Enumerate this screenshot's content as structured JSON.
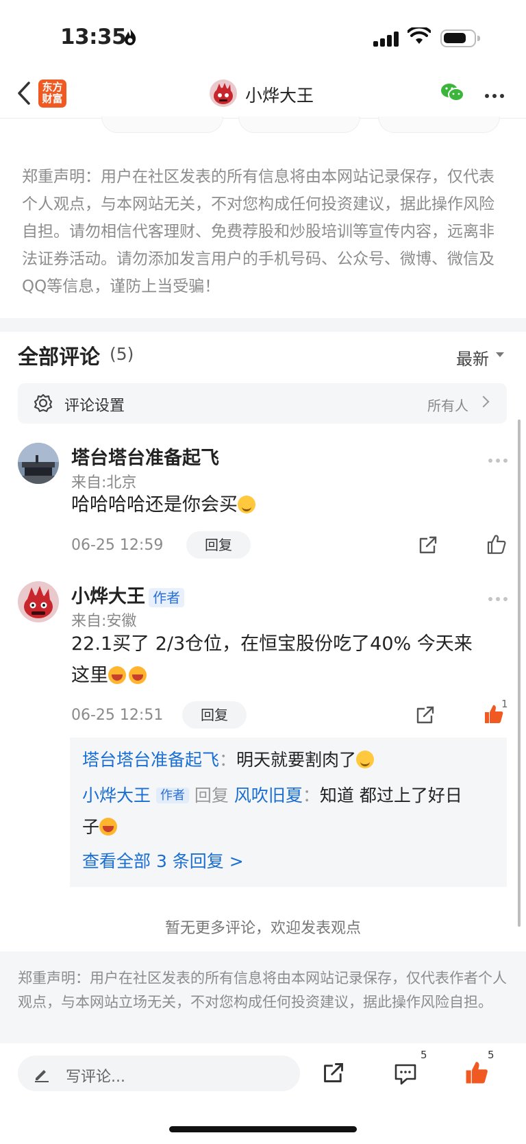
{
  "status_bar": {
    "time": "13:35"
  },
  "nav": {
    "logo_line1": "东方",
    "logo_line2": "财富",
    "title": "小烨大王"
  },
  "disclaimer_top": "郑重声明：用户在社区发表的所有信息将由本网站记录保存，仅代表个人观点，与本网站无关，不对您构成任何投资建议，据此操作风险自担。请勿相信代客理财、免费荐股和炒股培训等宣传内容，远离非法证券活动。请勿添加发言用户的手机号码、公众号、微博、微信及QQ等信息，谨防上当受骗！",
  "comments_header": {
    "title": "全部评论",
    "count": "(5)",
    "sort": "最新"
  },
  "comment_settings": {
    "label": "评论设置",
    "value": "所有人"
  },
  "comments": [
    {
      "user": "塔台塔台准备起飞",
      "from": "来自:北京",
      "text": "哈哈哈哈还是你会买",
      "emoji": "thinking-emoji",
      "date": "06-25 12:59",
      "reply_label": "回复"
    },
    {
      "user": "小烨大王",
      "author_badge": "作者",
      "from": "来自:安徽",
      "text_line1": "22.1买了 2/3仓位，在恒宝股份吃了40%  今天来",
      "text_line2": "这里",
      "date": "06-25 12:51",
      "reply_label": "回复",
      "like_count": "1",
      "replies": [
        {
          "user": "塔台塔台准备起飞",
          "sep": "：",
          "text": "明天就要割肉了"
        },
        {
          "user": "小烨大王",
          "author_badge": "作者",
          "reply_word": "回复",
          "target": "风吹旧夏",
          "sep": "：",
          "text1": "知道 都过上了好日",
          "text2": "子"
        }
      ],
      "view_all": "查看全部 3 条回复 >"
    }
  ],
  "no_more": "暂无更多评论，欢迎发表观点",
  "disclaimer_bottom": "郑重声明：用户在社区发表的所有信息将由本网站记录保存，仅代表作者个人观点，与本网站立场无关，不对您构成任何投资建议，据此操作风险自担。",
  "bottom_bar": {
    "placeholder": "写评论...",
    "comment_count": "5",
    "like_count": "5"
  },
  "colors": {
    "accent_orange": "#f05a22",
    "link_blue": "#1a6ed2",
    "like_orange": "#f05a22",
    "wechat_green": "#3bb53b"
  }
}
